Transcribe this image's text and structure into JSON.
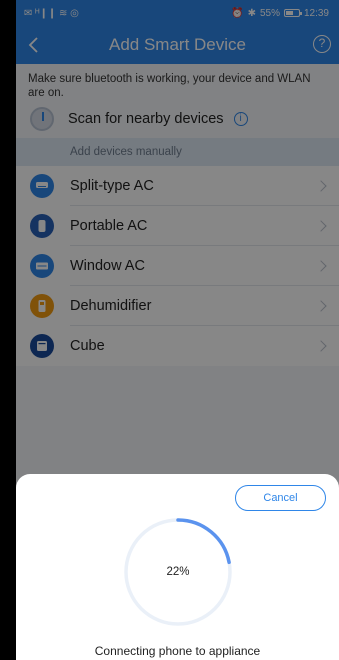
{
  "status_bar": {
    "left_glyphs": "✉ ᴴ❙❙ ≋ ◎",
    "alarm_glyph": "⏰",
    "bluetooth_glyph": "✱",
    "battery": "55%",
    "time": "12:39"
  },
  "header": {
    "title": "Add Smart Device",
    "back_icon": "chevron-left-icon",
    "help_icon": "question-circle-icon",
    "help_glyph": "?"
  },
  "notice": "Make sure bluetooth is working, your device and WLAN are on.",
  "scan": {
    "label": "Scan for nearby devices",
    "info_glyph": "i"
  },
  "manual_header": "Add devices manually",
  "devices": [
    {
      "label": "Split-type AC",
      "icon": "split-ac-icon",
      "color": "#2f86e8"
    },
    {
      "label": "Portable AC",
      "icon": "portable-ac-icon",
      "color": "#2860b8"
    },
    {
      "label": "Window AC",
      "icon": "window-ac-icon",
      "color": "#2f86e8"
    },
    {
      "label": "Dehumidifier",
      "icon": "dehumidifier-icon",
      "color": "#f19b12"
    },
    {
      "label": "Cube",
      "icon": "cube-icon",
      "color": "#1a4a9c"
    }
  ],
  "sheet": {
    "cancel_label": "Cancel",
    "progress_text": "22%",
    "progress": 0.22,
    "accent": "#5b93ee",
    "track": "#eaf0f8",
    "message": "Connecting phone to appliance"
  }
}
